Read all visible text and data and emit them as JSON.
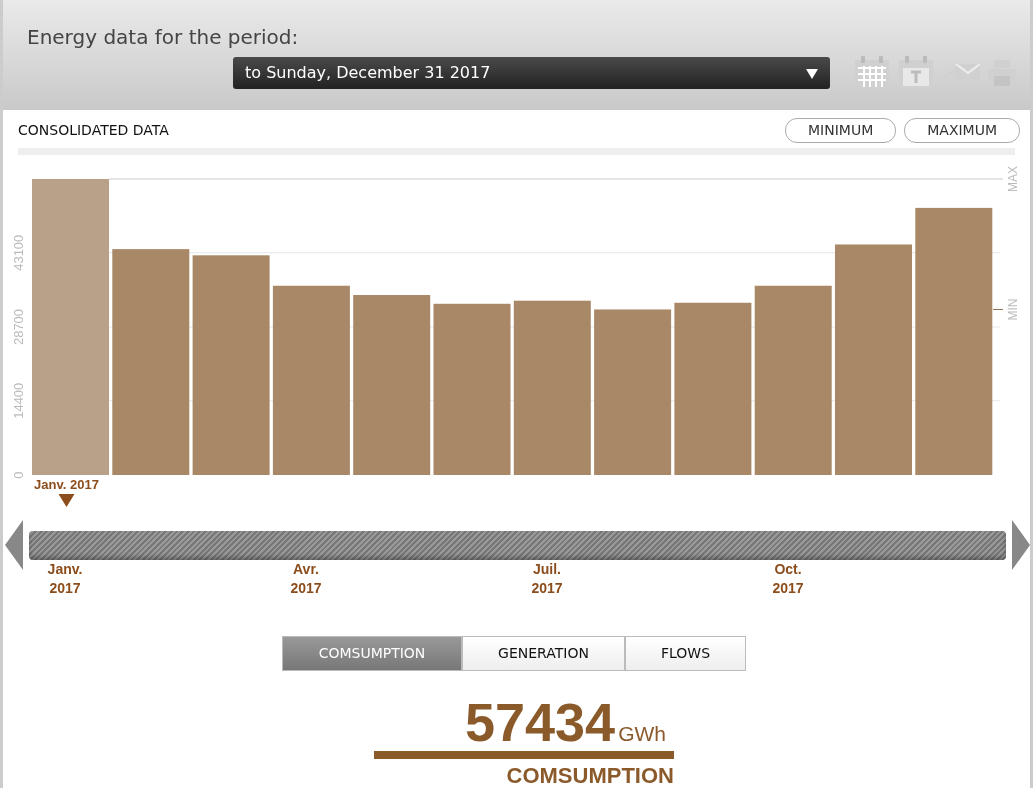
{
  "header": {
    "title": "Energy data for the period:",
    "period": "to Sunday, December 31 2017"
  },
  "section": {
    "title": "CONSOLIDATED DATA",
    "buttons": [
      "MINIMUM",
      "MAXIMUM"
    ]
  },
  "chart": {
    "selected_label": "Janv. 2017",
    "bars": [
      {
        "selected": true
      },
      {
        "selected": false
      },
      {
        "selected": false
      },
      {
        "selected": false
      },
      {
        "selected": false
      },
      {
        "selected": false
      },
      {
        "selected": false
      },
      {
        "selected": false
      },
      {
        "selected": false
      },
      {
        "selected": false
      },
      {
        "selected": false
      },
      {
        "selected": false
      }
    ],
    "chart_data": {
      "type": "bar",
      "values": [
        57400,
        43800,
        42600,
        36700,
        34900,
        33200,
        33800,
        32100,
        33400,
        36700,
        44700,
        51800
      ],
      "ylim": [
        0,
        57400
      ],
      "yticks": [
        0,
        14400,
        28700,
        43100
      ],
      "grid": true
    },
    "markers": [
      {
        "label": "MAX"
      },
      {
        "label": "MIN"
      }
    ]
  },
  "timeline": {
    "labels": [
      {
        "month": "Janv.",
        "year": "2017"
      },
      {
        "month": "Avr.",
        "year": "2017"
      },
      {
        "month": "Juil.",
        "year": "2017"
      },
      {
        "month": "Oct.",
        "year": "2017"
      }
    ]
  },
  "tabs": [
    {
      "label": "COMSUMPTION",
      "selected": true
    },
    {
      "label": "GENERATION",
      "selected": false
    },
    {
      "label": "FLOWS",
      "selected": false
    }
  ],
  "total": {
    "value": "57434",
    "unit": "GWh",
    "label": "COMSUMPTION"
  }
}
